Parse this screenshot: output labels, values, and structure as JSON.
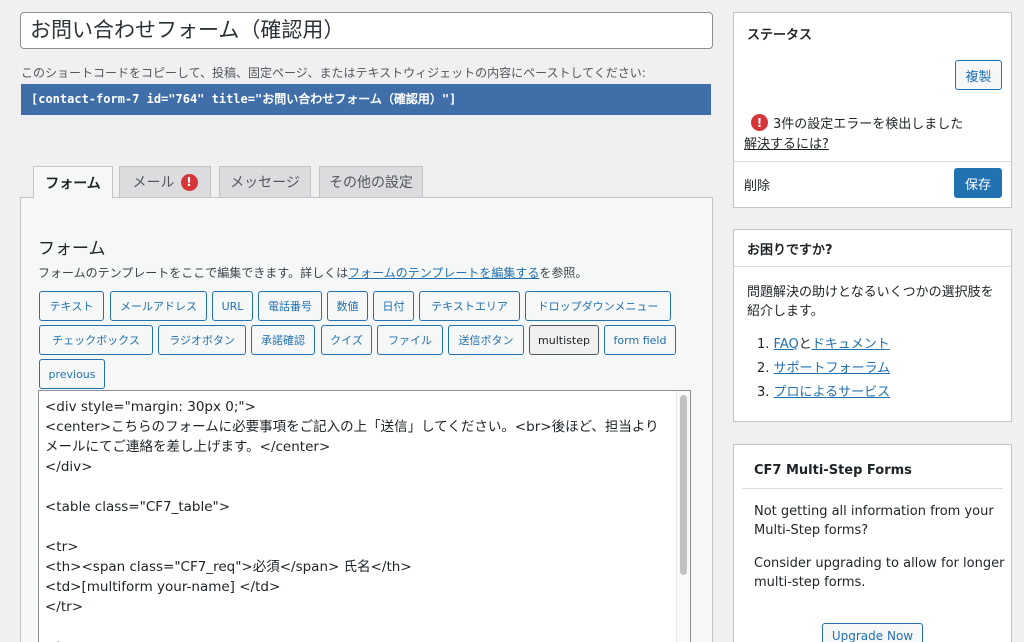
{
  "form_title": "お問い合わせフォーム（確認用）",
  "shortcode_desc": "このショートコードをコピーして、投稿、固定ページ、またはテキストウィジェットの内容にペーストしてください:",
  "shortcode": "[contact-form-7 id=\"764\" title=\"お問い合わせフォーム（確認用）\"]",
  "tabs": [
    {
      "label": "フォーム"
    },
    {
      "label": "メール",
      "warning": "!"
    },
    {
      "label": "メッセージ"
    },
    {
      "label": "その他の設定"
    }
  ],
  "form_panel": {
    "title": "フォーム",
    "desc_before": "フォームのテンプレートをここで編集できます。詳しくは",
    "desc_link": "フォームのテンプレートを編集する",
    "desc_after": "を参照。"
  },
  "tag_buttons": [
    "テキスト",
    "メールアドレス",
    "URL",
    "電話番号",
    "数値",
    "日付",
    "テキストエリア",
    "ドロップダウンメニュー",
    "チェックボックス",
    "ラジオボタン",
    "承諾確認",
    "クイズ",
    "ファイル",
    "送信ボタン",
    "multistep",
    "form field",
    "previous"
  ],
  "editor_content": "<div style=\"margin: 30px 0;\">\n<center>こちらのフォームに必要事項をご記入の上「送信」してください。<br>後ほど、担当よりメールにてご連絡を差し上げます。</center>\n</div>\n\n<table class=\"CF7_table\">\n\n<tr>\n<th><span class=\"CF7_req\">必須</span> 氏名</th>\n<td>[multiform your-name] </td>\n</tr>\n\n<tr>",
  "status_box": {
    "title": "ステータス",
    "duplicate": "複製",
    "warning": "!",
    "error_text": "3件の設定エラーを検出しました",
    "help_link": "解決するには?",
    "delete": "削除",
    "save": "保存"
  },
  "help_box": {
    "title": "お困りですか?",
    "desc_line1": "問題解決の助けとなるいくつかの選択肢を",
    "desc_line2": "紹介します。",
    "item1_num": "1.",
    "item1_link_a": "FAQ",
    "item1_and": "と",
    "item1_link_b": "ドキュメント",
    "item2_num": "2.",
    "item2_link": "サポートフォーラム",
    "item3_num": "3.",
    "item3_link": "プロによるサービス"
  },
  "cf7ms_box": {
    "title": "CF7 Multi-Step Forms",
    "p1_line1": "Not getting all information from your",
    "p1_line2": "Multi-Step forms?",
    "p2_line1": "Consider upgrading to allow for longer",
    "p2_line2": "multi-step forms.",
    "upgrade": "Upgrade Now"
  },
  "colors": {
    "accent": "#2271b1",
    "shortcode_bg": "#3f6ea8",
    "error": "#d63638",
    "delete": "#b32d2e"
  }
}
